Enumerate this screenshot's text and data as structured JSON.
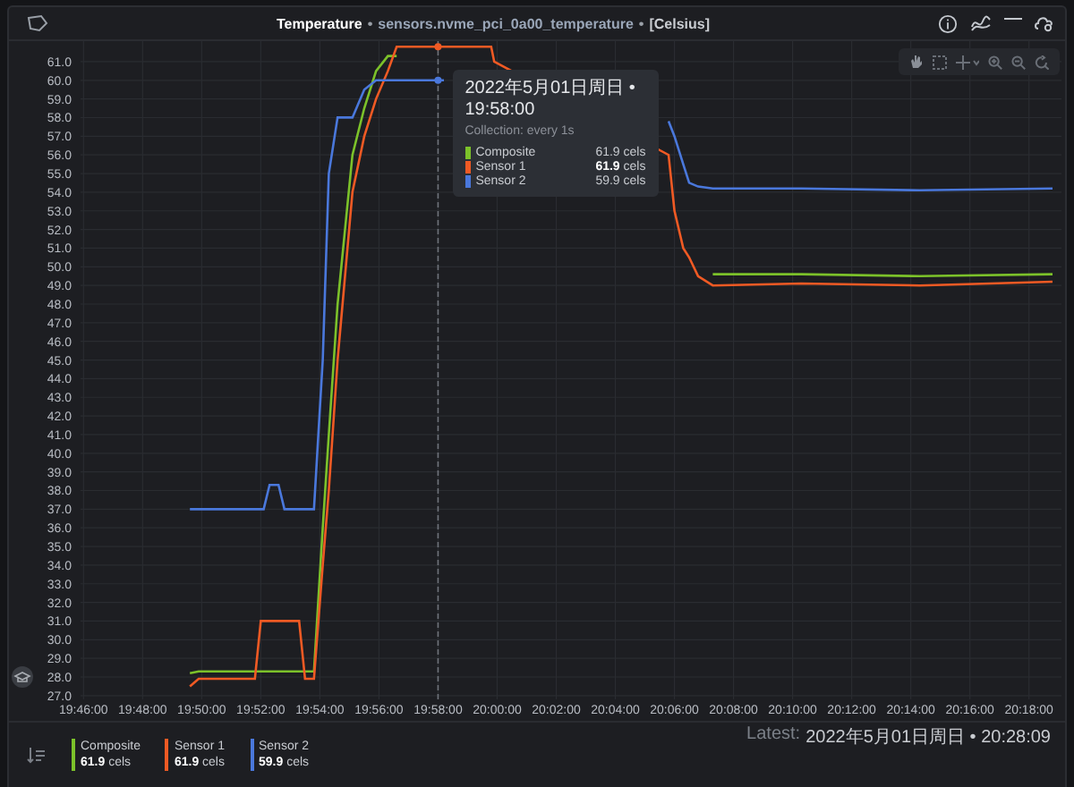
{
  "window": {
    "title": "Temperature",
    "separators": [
      "•",
      "•"
    ],
    "context": "sensors.nvme_pci_0a00_temperature",
    "units": "[Celsius]"
  },
  "chart": {
    "chart_data": {
      "type": "line",
      "grid": true,
      "x": [
        1189.6,
        1189.9,
        1191.8,
        1192.0,
        1192.1,
        1192.3,
        1192.6,
        1192.8,
        1193.3,
        1193.5,
        1193.8,
        1194.1,
        1194.3,
        1194.6,
        1195.1,
        1195.5,
        1195.9,
        1196.3,
        1196.6,
        1197.3,
        1198.2,
        1199.8,
        1199.9,
        1205.8,
        1206.0,
        1206.3,
        1206.5,
        1206.8,
        1207.3,
        1210.3,
        1214.3,
        1218.8
      ],
      "series": [
        {
          "name": "Composite",
          "color": "#7cc22a",
          "values": [
            28.2,
            28.3,
            28.3,
            28.3,
            28.3,
            28.3,
            28.3,
            28.3,
            28.3,
            28.3,
            28.3,
            36,
            41,
            48,
            56,
            58.5,
            60.5,
            61.3,
            61.3,
            null,
            null,
            null,
            null,
            null,
            null,
            null,
            null,
            null,
            49.6,
            49.6,
            49.5,
            49.6
          ]
        },
        {
          "name": "Sensor 1",
          "color": "#f05a24",
          "values": [
            27.5,
            27.9,
            27.9,
            31,
            31,
            31,
            31,
            31,
            31,
            27.9,
            27.9,
            34,
            38,
            45,
            54,
            57,
            59,
            60.5,
            61.8,
            61.8,
            61.8,
            61.8,
            61.0,
            56,
            53,
            51,
            50.5,
            49.5,
            49,
            49.1,
            49,
            49.2
          ]
        },
        {
          "name": "Sensor 2",
          "color": "#4a78dc",
          "values": [
            37,
            37,
            37,
            37,
            37,
            38.3,
            38.3,
            37,
            37,
            37,
            37,
            45,
            55,
            58,
            58,
            59.5,
            60,
            60,
            60,
            60,
            60,
            null,
            null,
            57.8,
            57,
            55.5,
            54.5,
            54.3,
            54.2,
            54.2,
            54.1,
            54.2
          ]
        }
      ],
      "xlim": [
        1185.9,
        1219.1
      ],
      "ylim": [
        26.8,
        62.1
      ],
      "xticks": [
        {
          "value": 1186,
          "label": "19:46:00"
        },
        {
          "value": 1188,
          "label": "19:48:00"
        },
        {
          "value": 1190,
          "label": "19:50:00"
        },
        {
          "value": 1192,
          "label": "19:52:00"
        },
        {
          "value": 1194,
          "label": "19:54:00"
        },
        {
          "value": 1196,
          "label": "19:56:00"
        },
        {
          "value": 1198,
          "label": "19:58:00"
        },
        {
          "value": 1200,
          "label": "20:00:00"
        },
        {
          "value": 1202,
          "label": "20:02:00"
        },
        {
          "value": 1204,
          "label": "20:04:00"
        },
        {
          "value": 1206,
          "label": "20:06:00"
        },
        {
          "value": 1208,
          "label": "20:08:00"
        },
        {
          "value": 1210,
          "label": "20:10:00"
        },
        {
          "value": 1212,
          "label": "20:12:00"
        },
        {
          "value": 1214,
          "label": "20:14:00"
        },
        {
          "value": 1216,
          "label": "20:16:00"
        },
        {
          "value": 1218,
          "label": "20:18:00"
        }
      ],
      "yticks": [
        {
          "value": 27,
          "label": "27.0"
        },
        {
          "value": 28,
          "label": "28.0"
        },
        {
          "value": 29,
          "label": "29.0"
        },
        {
          "value": 30,
          "label": "30.0"
        },
        {
          "value": 31,
          "label": "31.0"
        },
        {
          "value": 32,
          "label": "32.0"
        },
        {
          "value": 33,
          "label": "33.0"
        },
        {
          "value": 34,
          "label": "34.0"
        },
        {
          "value": 35,
          "label": "35.0"
        },
        {
          "value": 36,
          "label": "36.0"
        },
        {
          "value": 37,
          "label": "37.0"
        },
        {
          "value": 38,
          "label": "38.0"
        },
        {
          "value": 39,
          "label": "39.0"
        },
        {
          "value": 40,
          "label": "40.0"
        },
        {
          "value": 41,
          "label": "41.0"
        },
        {
          "value": 42,
          "label": "42.0"
        },
        {
          "value": 43,
          "label": "43.0"
        },
        {
          "value": 44,
          "label": "44.0"
        },
        {
          "value": 45,
          "label": "45.0"
        },
        {
          "value": 46,
          "label": "46.0"
        },
        {
          "value": 47,
          "label": "47.0"
        },
        {
          "value": 48,
          "label": "48.0"
        },
        {
          "value": 49,
          "label": "49.0"
        },
        {
          "value": 50,
          "label": "50.0"
        },
        {
          "value": 51,
          "label": "51.0"
        },
        {
          "value": 52,
          "label": "52.0"
        },
        {
          "value": 53,
          "label": "53.0"
        },
        {
          "value": 54,
          "label": "54.0"
        },
        {
          "value": 55,
          "label": "55.0"
        },
        {
          "value": 56,
          "label": "56.0"
        },
        {
          "value": 57,
          "label": "57.0"
        },
        {
          "value": 58,
          "label": "58.0"
        },
        {
          "value": 59,
          "label": "59.0"
        },
        {
          "value": 60,
          "label": "60.0"
        },
        {
          "value": 61,
          "label": "61.0"
        }
      ],
      "ref_lines": [
        {
          "axis": "x",
          "value": 1198
        }
      ]
    },
    "tooltip": {
      "time": "2022年5月01日周日 • 19:58:00",
      "collection": "Collection: every 1s",
      "rows": [
        {
          "name": "Composite",
          "value": "61.9 cels",
          "color": "#7cc22a",
          "emphasized": false
        },
        {
          "name": "Sensor 1",
          "value": "61.9",
          "unit": "cels",
          "color": "#f05a24",
          "emphasized": true
        },
        {
          "name": "Sensor 2",
          "value": "59.9 cels",
          "color": "#4a78dc",
          "emphasized": false
        }
      ]
    }
  },
  "legend": {
    "items": [
      {
        "value": "61.9",
        "unit": "cels"
      },
      {
        "value": "61.9",
        "unit": "cels"
      },
      {
        "value": "59.9",
        "unit": "cels"
      }
    ],
    "latest_label": "Latest:",
    "latest_value": "2022年5月01日周日 • 20:28:09"
  }
}
